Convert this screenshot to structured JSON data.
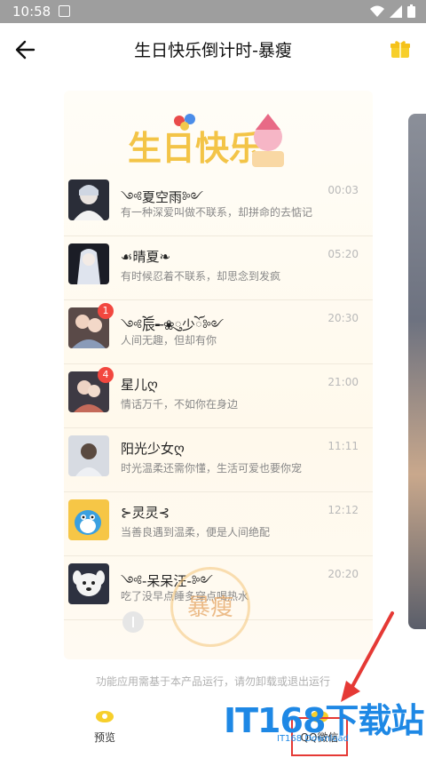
{
  "status_bar": {
    "time": "10:58"
  },
  "app_bar": {
    "title": "生日快乐倒计时-暴瘦"
  },
  "preview": {
    "rows": [
      {
        "name": "༺夏空雨༻",
        "message": "有一种深爱叫做不联系，却拼命的去惦记",
        "time": "00:03",
        "badge": ""
      },
      {
        "name": "☙晴夏❧",
        "message": "有时候忍着不联系，却思念到发疯",
        "time": "05:20",
        "badge": ""
      },
      {
        "name": "༺ོ辰╾❀ུ少ོ༻",
        "message": "人间无趣，但却有你",
        "time": "20:30",
        "badge": "1"
      },
      {
        "name": "星儿ღ",
        "message": "情话万千，不如你在身边",
        "time": "21:00",
        "badge": "4"
      },
      {
        "name": "阳光少女ღ",
        "message": "时光温柔还需你懂，生活可爱也要你宠",
        "time": "11:11",
        "badge": ""
      },
      {
        "name": "⊱灵灵⊰",
        "message": "当善良遇到温柔，便是人间绝配",
        "time": "12:12",
        "badge": ""
      },
      {
        "name": "༺-呆呆汪-༻",
        "message": "吃了没早点睡多穿点喝热水",
        "time": "20:20",
        "badge": ""
      }
    ],
    "watermark_text": "暴瘦"
  },
  "notice": "功能应用需基于本产品运行，请勿卸载或退出运行",
  "bottom_tabs": [
    {
      "label": "预览"
    },
    {
      "label": "QQ微信"
    }
  ],
  "brand": {
    "name": "IT168下载站",
    "sub": "IT168 Download"
  },
  "colors": {
    "accent": "#F7CF2B",
    "badge": "#F2473F",
    "highlight": "#E53935",
    "brand": "#1E88E5"
  }
}
